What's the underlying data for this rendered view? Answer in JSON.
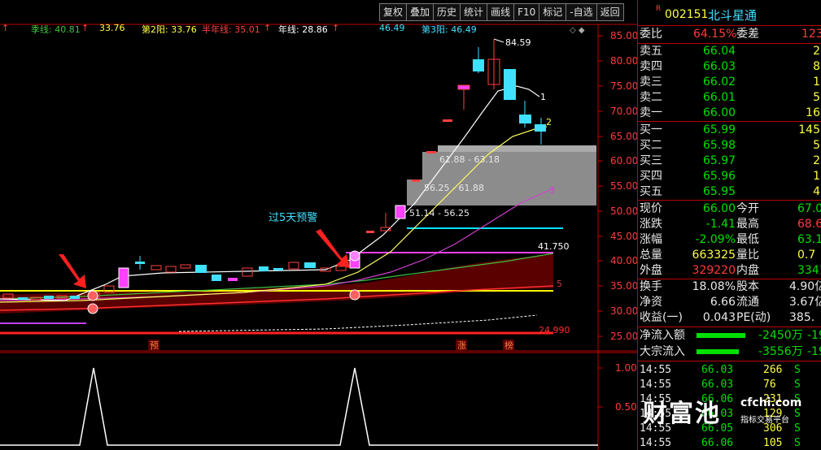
{
  "toolbar": {
    "buttons": [
      "复权",
      "叠加",
      "历史",
      "统计",
      "画线",
      "F10",
      "标记",
      "-自选",
      "返回"
    ]
  },
  "ma_line": {
    "season_label": "季线: 40.81",
    "season_arrow": "↑",
    "v1": "33.76",
    "second_yang": "第2阳: 33.76",
    "half_year": "半年线: 35.01",
    "half_year_arrow": "↑",
    "year_line": "年线: 28.86",
    "year_arrow": "↑",
    "v2": "46.49",
    "third_yang": "第3阳: 46.49"
  },
  "main_axis": {
    "ticks": [
      "85.00",
      "80.00",
      "75.00",
      "70.00",
      "65.00",
      "60.00",
      "55.00",
      "50.00",
      "45.00",
      "40.00",
      "35.00",
      "30.00",
      "25.00"
    ]
  },
  "sub_axis": {
    "ticks": [
      "1.00",
      "0.50"
    ]
  },
  "annotations": {
    "high": "84.59",
    "ma_label_1": "1",
    "ma_label_2": "2",
    "ma_label_3": "3",
    "zone_1": "61.88 - 63.18",
    "zone_2": "56.25 - 61.88",
    "zone_3": "51.14 - 56.25",
    "warn_text": "过5天预警",
    "level_41": "41.750",
    "level_5": "5",
    "low": "24.990",
    "tag_pre": "预",
    "tag_zhang": "涨",
    "tag_bang": "榜"
  },
  "quote": {
    "code": "002151",
    "name": "北斗星通",
    "weibi_label": "委比",
    "weibi_value": "64.15%",
    "weicha_label": "委差",
    "weicha_value": "123",
    "asks": [
      {
        "label": "卖五",
        "price": "66.04",
        "vol": "2"
      },
      {
        "label": "卖四",
        "price": "66.03",
        "vol": "8"
      },
      {
        "label": "卖三",
        "price": "66.02",
        "vol": "1"
      },
      {
        "label": "卖二",
        "price": "66.01",
        "vol": "5"
      },
      {
        "label": "卖一",
        "price": "66.00",
        "vol": "16"
      }
    ],
    "bids": [
      {
        "label": "买一",
        "price": "65.99",
        "vol": "145"
      },
      {
        "label": "买二",
        "price": "65.98",
        "vol": "5"
      },
      {
        "label": "买三",
        "price": "65.97",
        "vol": "2"
      },
      {
        "label": "买四",
        "price": "65.96",
        "vol": "1"
      },
      {
        "label": "买五",
        "price": "65.95",
        "vol": "4"
      }
    ],
    "stats": [
      {
        "l1": "现价",
        "v1": "66.00",
        "c1": "green",
        "l2": "今开",
        "v2": "67.0",
        "c2": "green"
      },
      {
        "l1": "涨跌",
        "v1": "-1.41",
        "c1": "green",
        "l2": "最高",
        "v2": "68.6",
        "c2": "red"
      },
      {
        "l1": "涨幅",
        "v1": "-2.09%",
        "c1": "green",
        "l2": "最低",
        "v2": "63.1",
        "c2": "green"
      },
      {
        "l1": "总量",
        "v1": "663325",
        "c1": "yellow",
        "l2": "量比",
        "v2": "0.7",
        "c2": "yellow"
      },
      {
        "l1": "外盘",
        "v1": "329220",
        "c1": "red",
        "l2": "内盘",
        "v2": "33410",
        "c2": "green"
      }
    ],
    "stats2": [
      {
        "l1": "换手",
        "v1": "18.08%",
        "l2": "股本",
        "v2": "4.90亿"
      },
      {
        "l1": "净资",
        "v1": "6.66",
        "l2": "流通",
        "v2": "3.67亿"
      },
      {
        "l1": "收益(一)",
        "v1": "0.043",
        "l2": "PE(动)",
        "v2": "385."
      }
    ],
    "flows": [
      {
        "label": "净流入额",
        "value": "-2450万",
        "pct": "-19"
      },
      {
        "label": "大宗流入",
        "value": "-3556万",
        "pct": "-19"
      }
    ],
    "trades": [
      {
        "time": "14:55",
        "price": "66.03",
        "vol": "266",
        "side": "S"
      },
      {
        "time": "14:55",
        "price": "66.03",
        "vol": "76",
        "side": "S"
      },
      {
        "time": "14:55",
        "price": "66.06",
        "vol": "231",
        "side": "S"
      },
      {
        "time": "14:55",
        "price": "66.03",
        "vol": "129",
        "side": "S"
      },
      {
        "time": "14:55",
        "price": "66.05",
        "vol": "306",
        "side": "S"
      },
      {
        "time": "14:55",
        "price": "66.06",
        "vol": "105",
        "side": "S"
      }
    ]
  },
  "watermark": {
    "brand": "财富池",
    "url": "cfchi.com",
    "sub": "指标交易平台"
  }
}
